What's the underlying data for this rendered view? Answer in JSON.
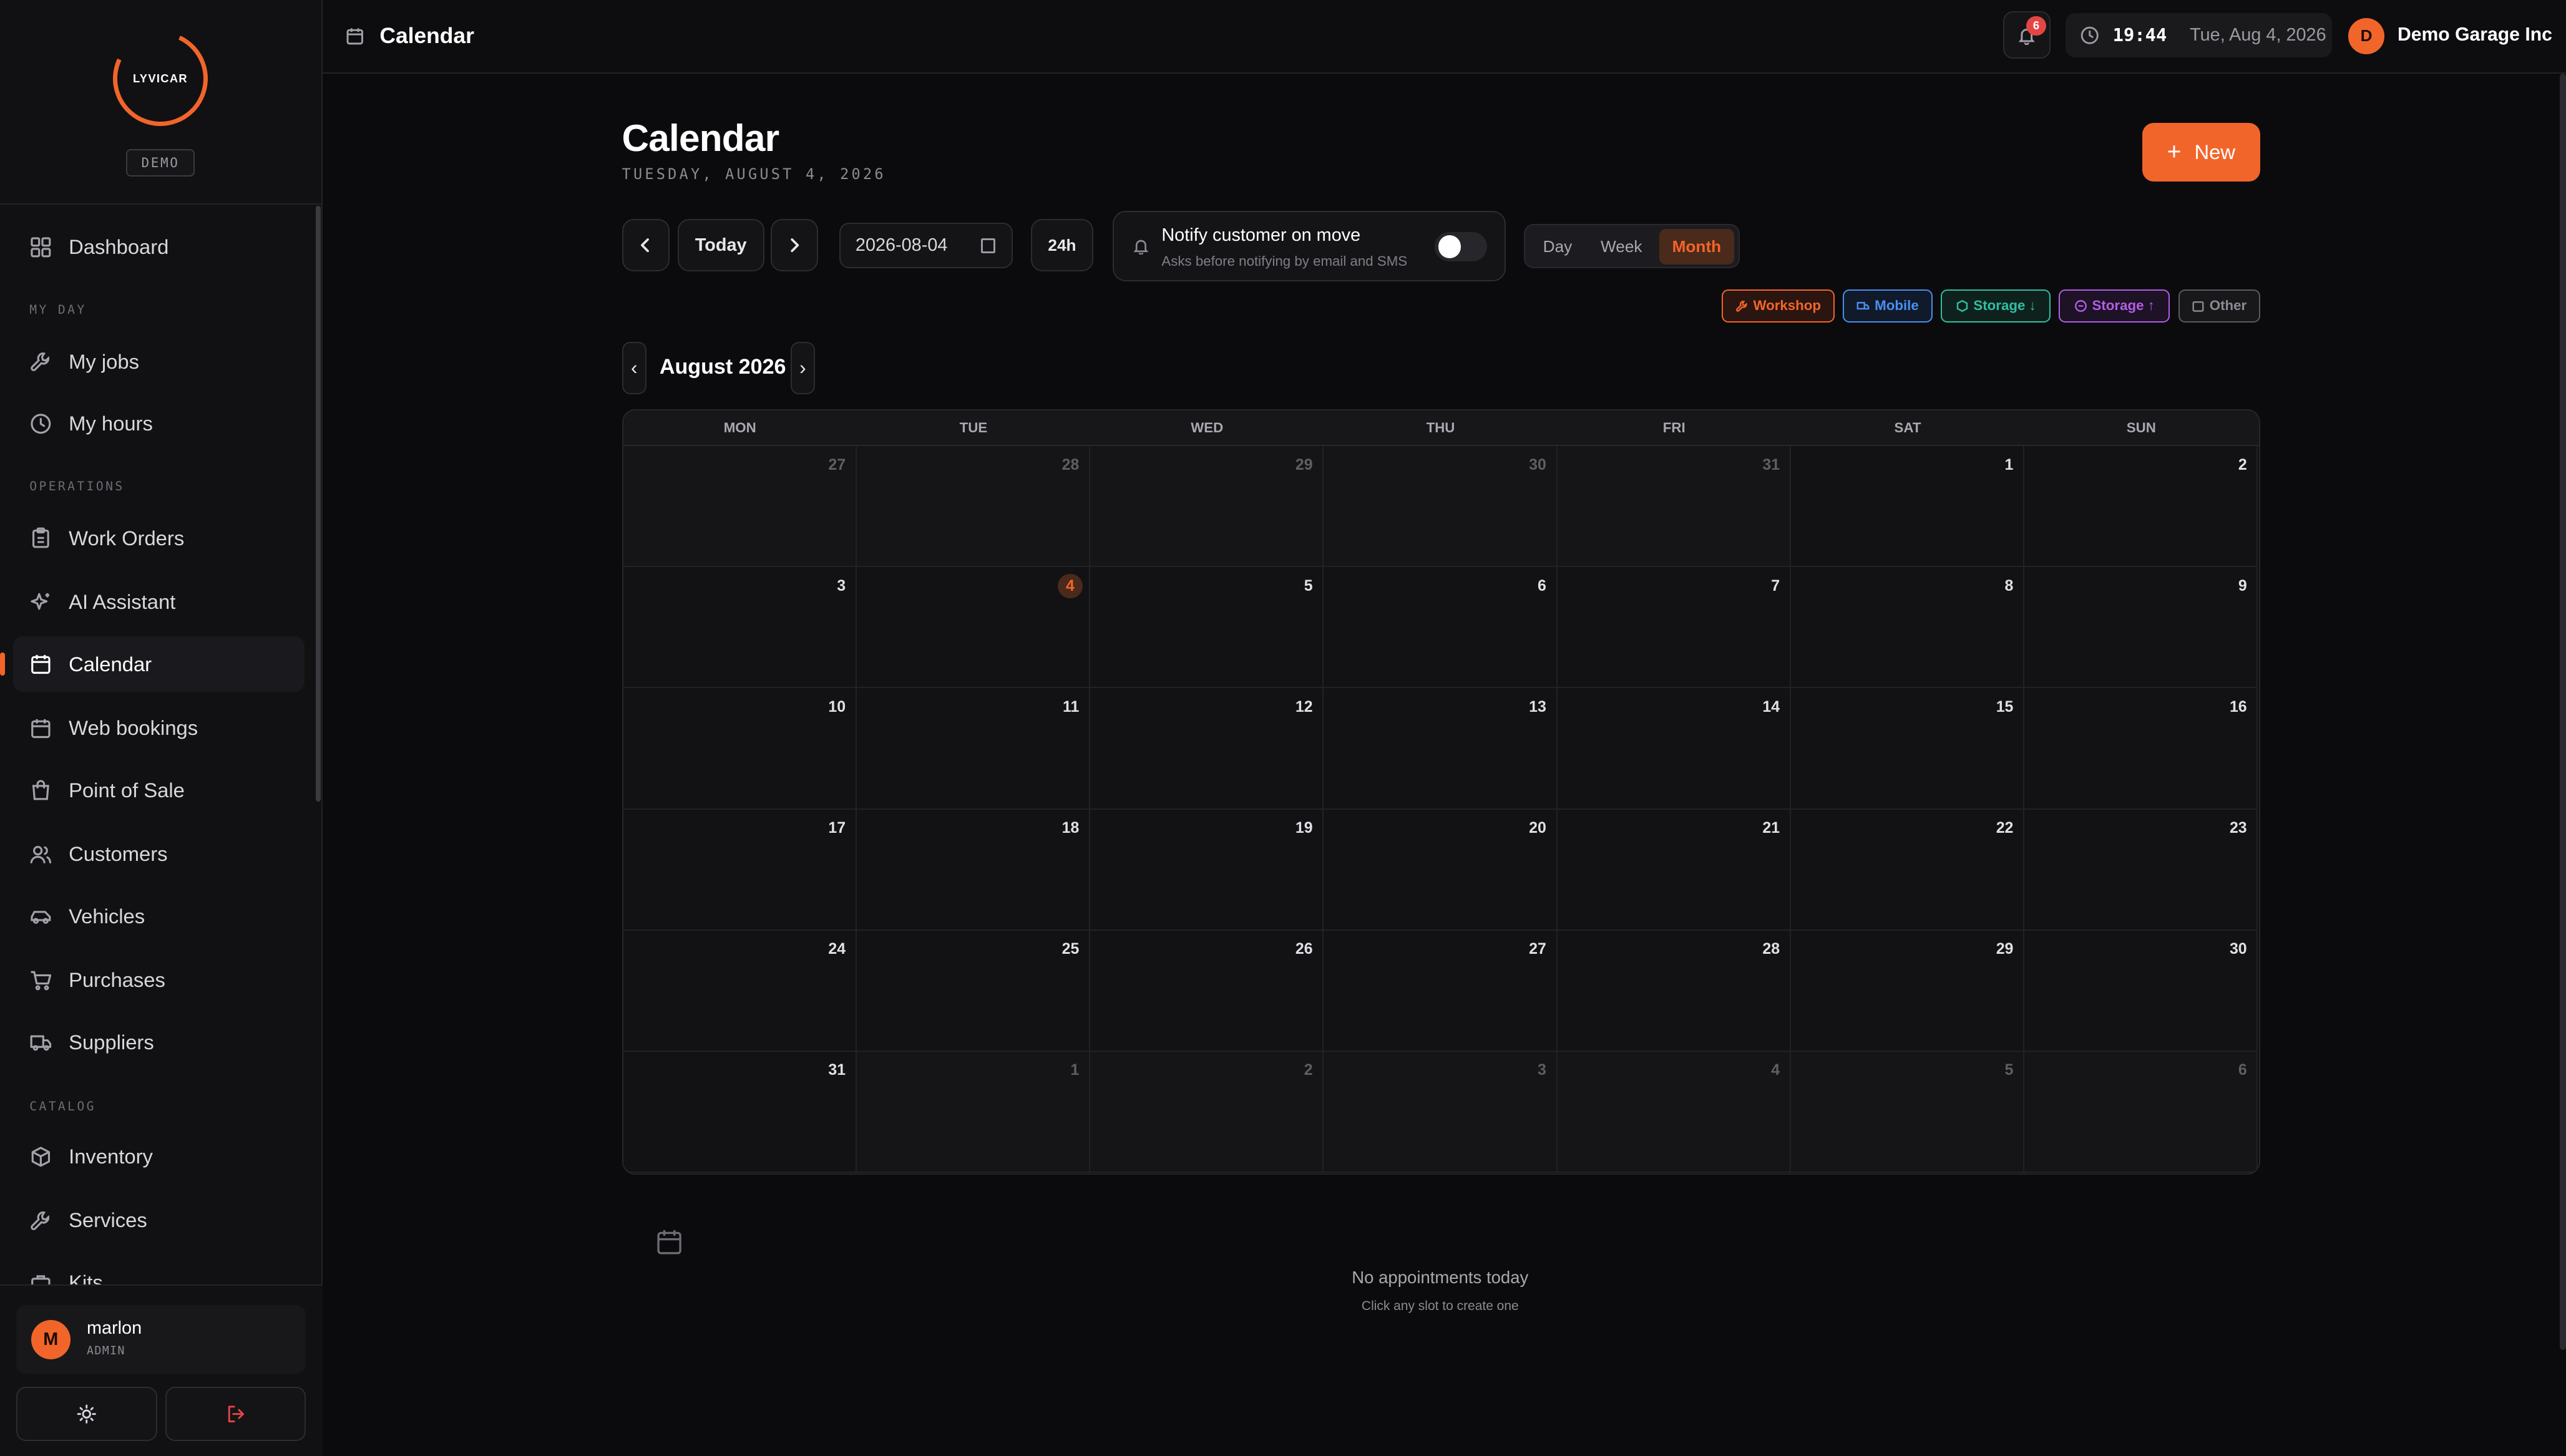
{
  "brand": {
    "logo_text": "LYVICAR",
    "badge": "DEMO"
  },
  "sidebar": {
    "items": [
      {
        "label": "Dashboard",
        "icon": "grid-icon"
      },
      {
        "label": "My jobs",
        "icon": "wrench-icon"
      },
      {
        "label": "My hours",
        "icon": "clock-icon"
      },
      {
        "label": "Work Orders",
        "icon": "clipboard-icon"
      },
      {
        "label": "AI Assistant",
        "icon": "sparkle-icon"
      },
      {
        "label": "Calendar",
        "icon": "calendar-icon",
        "active": true
      },
      {
        "label": "Web bookings",
        "icon": "calendar-icon"
      },
      {
        "label": "Point of Sale",
        "icon": "bag-icon"
      },
      {
        "label": "Customers",
        "icon": "users-icon"
      },
      {
        "label": "Vehicles",
        "icon": "car-icon"
      },
      {
        "label": "Purchases",
        "icon": "cart-icon"
      },
      {
        "label": "Suppliers",
        "icon": "truck-icon"
      },
      {
        "label": "Inventory",
        "icon": "box-icon"
      },
      {
        "label": "Services",
        "icon": "wrench-icon"
      },
      {
        "label": "Kits",
        "icon": "kit-icon"
      }
    ],
    "sections": [
      "MY DAY",
      "OPERATIONS",
      "CATALOG"
    ],
    "user": {
      "initial": "M",
      "name": "marlon",
      "role": "ADMIN"
    }
  },
  "topbar": {
    "title": "Calendar",
    "notification_count": "6",
    "time": "19:44",
    "date": "Tue, Aug 4, 2026",
    "org_initial": "D",
    "org_name": "Demo Garage Inc"
  },
  "page": {
    "title": "Calendar",
    "subtitle": "TUESDAY, AUGUST 4, 2026",
    "new_label": "New"
  },
  "toolbar": {
    "today_label": "Today",
    "date_value": "2026-08-04",
    "hours_label": "24h",
    "notify_title": "Notify customer on move",
    "notify_sub": "Asks before notifying by email and SMS",
    "notify_on": false,
    "views": [
      "Day",
      "Week",
      "Month"
    ],
    "active_view": "Month"
  },
  "legend": [
    {
      "label": "Workshop",
      "color": "#f2652a"
    },
    {
      "label": "Mobile",
      "color": "#4b8ef0"
    },
    {
      "label": "Storage ↓",
      "color": "#2fbfa0"
    },
    {
      "label": "Storage ↑",
      "color": "#b45ce6"
    },
    {
      "label": "Other",
      "color": "#8a8a92"
    }
  ],
  "calendar": {
    "month_label": "August 2026",
    "weekdays": [
      "MON",
      "TUE",
      "WED",
      "THU",
      "FRI",
      "SAT",
      "SUN"
    ],
    "weeks": [
      [
        {
          "d": "27",
          "o": true
        },
        {
          "d": "28",
          "o": true
        },
        {
          "d": "29",
          "o": true
        },
        {
          "d": "30",
          "o": true
        },
        {
          "d": "31",
          "o": true
        },
        {
          "d": "1"
        },
        {
          "d": "2"
        }
      ],
      [
        {
          "d": "3"
        },
        {
          "d": "4",
          "today": true
        },
        {
          "d": "5"
        },
        {
          "d": "6"
        },
        {
          "d": "7"
        },
        {
          "d": "8"
        },
        {
          "d": "9"
        }
      ],
      [
        {
          "d": "10"
        },
        {
          "d": "11"
        },
        {
          "d": "12"
        },
        {
          "d": "13"
        },
        {
          "d": "14"
        },
        {
          "d": "15"
        },
        {
          "d": "16"
        }
      ],
      [
        {
          "d": "17"
        },
        {
          "d": "18"
        },
        {
          "d": "19"
        },
        {
          "d": "20"
        },
        {
          "d": "21"
        },
        {
          "d": "22"
        },
        {
          "d": "23"
        }
      ],
      [
        {
          "d": "24"
        },
        {
          "d": "25"
        },
        {
          "d": "26"
        },
        {
          "d": "27"
        },
        {
          "d": "28"
        },
        {
          "d": "29"
        },
        {
          "d": "30"
        }
      ],
      [
        {
          "d": "31"
        },
        {
          "d": "1",
          "o": true
        },
        {
          "d": "2",
          "o": true
        },
        {
          "d": "3",
          "o": true
        },
        {
          "d": "4",
          "o": true
        },
        {
          "d": "5",
          "o": true
        },
        {
          "d": "6",
          "o": true
        }
      ]
    ]
  },
  "empty_state": {
    "title": "No appointments today",
    "subtitle": "Click any slot to create one"
  }
}
